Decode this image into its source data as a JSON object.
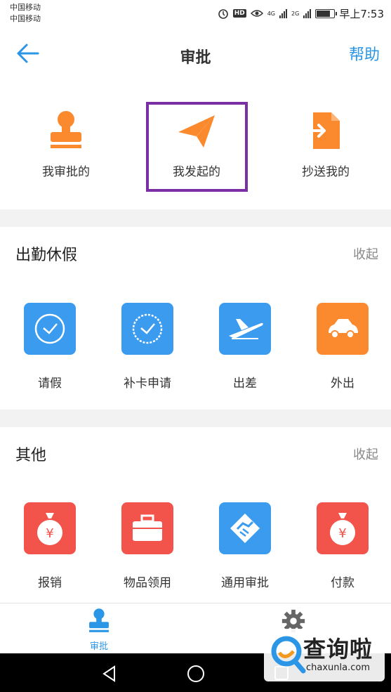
{
  "status": {
    "carrier1": "中国移动",
    "carrier2": "中国移动",
    "net1": "4G",
    "net2": "2G",
    "hd": "HD",
    "time": "早上7:53"
  },
  "nav": {
    "title": "审批",
    "help": "帮助"
  },
  "top_tabs": [
    {
      "label": "我审批的",
      "icon": "stamp-icon",
      "color": "#fb8a2f"
    },
    {
      "label": "我发起的",
      "icon": "paper-plane-icon",
      "color": "#fb8a2f",
      "highlighted": true
    },
    {
      "label": "抄送我的",
      "icon": "forward-document-icon",
      "color": "#fb8a2f"
    }
  ],
  "attendance": {
    "title": "出勤休假",
    "toggle": "收起",
    "items": [
      {
        "label": "请假",
        "icon": "clock-icon",
        "color": "#3a9bef"
      },
      {
        "label": "补卡申请",
        "icon": "clock-icon",
        "color": "#3a9bef"
      },
      {
        "label": "出差",
        "icon": "airplane-icon",
        "color": "#3a9bef"
      },
      {
        "label": "外出",
        "icon": "car-icon",
        "color": "#fb8a2f"
      }
    ]
  },
  "other": {
    "title": "其他",
    "toggle": "收起",
    "items": [
      {
        "label": "报销",
        "icon": "money-bag-icon",
        "color": "#f2534a"
      },
      {
        "label": "物品领用",
        "icon": "toolbox-icon",
        "color": "#f2534a"
      },
      {
        "label": "通用审批",
        "icon": "handshake-icon",
        "color": "#3a9bef"
      },
      {
        "label": "付款",
        "icon": "money-bag-icon",
        "color": "#f2534a"
      }
    ]
  },
  "tabbar": {
    "approval": "审批"
  },
  "watermark": {
    "text": "查询啦",
    "sub": "chaxunla.com"
  }
}
